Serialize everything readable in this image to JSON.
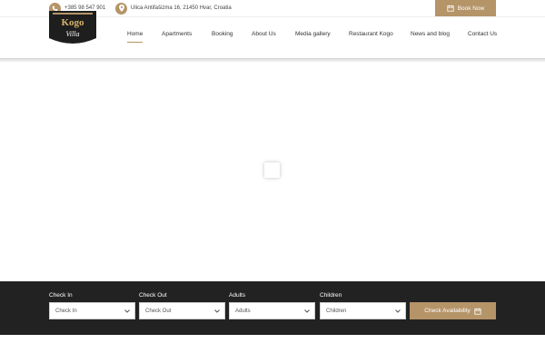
{
  "topbar": {
    "phone": "+385 98 547 901",
    "address": "Ulica Antifašizma 16, 21450 Hvar, Croatia",
    "book_now": "Book Now",
    "phone_icon": "phone-icon",
    "location_icon": "location-pin-icon"
  },
  "logo": {
    "top_text": "Kogo",
    "bottom_text": "Villa"
  },
  "nav": {
    "items": [
      "Home",
      "Apartments",
      "Booking",
      "About Us",
      "Media gallery",
      "Restaurant Kogo",
      "News and blog",
      "Contact Us"
    ],
    "active": "Home"
  },
  "booking": {
    "check_in_label": "Check In",
    "check_in_value": "Check In",
    "check_out_label": "Check Out",
    "check_out_value": "Check Out",
    "adults_label": "Adults",
    "adults_value": "Adults",
    "children_label": "Children",
    "children_value": "Children",
    "check_button": "Check Availability",
    "calendar_icon": "calendar-icon"
  },
  "colors": {
    "accent": "#b59468",
    "booking_bar": "#222222"
  }
}
